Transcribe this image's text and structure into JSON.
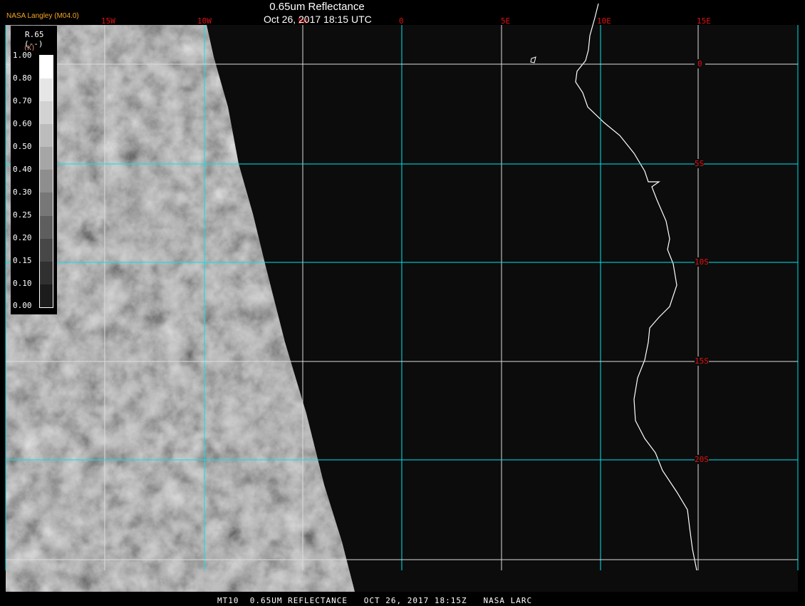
{
  "header": {
    "title": "0.65um Reflectance",
    "datetime": "Oct 26, 2017 18:15 UTC",
    "credit": "NASA Langley (M04.0)"
  },
  "grid": {
    "longitudes": [
      "15W",
      "10W",
      "5W",
      "0",
      "5E",
      "10E",
      "15E"
    ],
    "latitudes": [
      "0",
      "5S",
      "10S",
      "15S",
      "20S"
    ]
  },
  "legend": {
    "title": "R.65",
    "unit": "(--)",
    "unit_alt": "(K)",
    "ticks": [
      "1.00",
      "0.80",
      "0.70",
      "0.60",
      "0.50",
      "0.40",
      "0.30",
      "0.25",
      "0.20",
      "0.15",
      "0.10",
      "0.00"
    ],
    "colors": [
      "#ffffff",
      "#e6e6e6",
      "#d2d2d2",
      "#bcbcbc",
      "#a6a6a6",
      "#8e8e8e",
      "#777777",
      "#5e5e5e",
      "#474747",
      "#303030",
      "#1c1c1c"
    ]
  },
  "footer": "MT10  0.65UM REFLECTANCE   OCT 26, 2017 18:15Z   NASA LARC"
}
